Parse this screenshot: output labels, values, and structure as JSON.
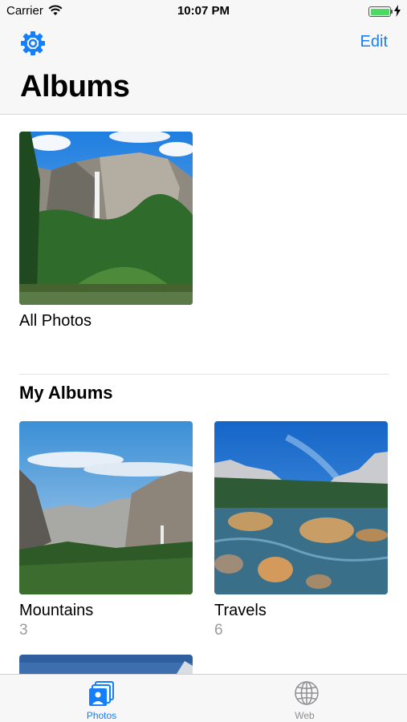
{
  "status_bar": {
    "carrier": "Carrier",
    "time": "10:07 PM",
    "wifi_icon": "wifi-icon",
    "battery_icon": "battery-charging-icon",
    "battery_color": "#4cd964"
  },
  "nav": {
    "settings_icon": "gear-icon",
    "edit_label": "Edit",
    "title": "Albums",
    "accent_color": "#147efb"
  },
  "all_photos": {
    "name": "All Photos",
    "thumbnail": "yosemite-falls-photo"
  },
  "my_albums": {
    "title": "My Albums",
    "albums": [
      {
        "name": "Mountains",
        "count": "3",
        "thumbnail": "yosemite-valley-photo"
      },
      {
        "name": "Travels",
        "count": "6",
        "thumbnail": "river-rocks-photo"
      },
      {
        "thumbnail": "partially-visible-photo"
      }
    ]
  },
  "tab_bar": {
    "tabs": [
      {
        "label": "Photos",
        "icon": "photos-stack-icon",
        "selected": true
      },
      {
        "label": "Web",
        "icon": "globe-icon",
        "selected": false
      }
    ]
  }
}
